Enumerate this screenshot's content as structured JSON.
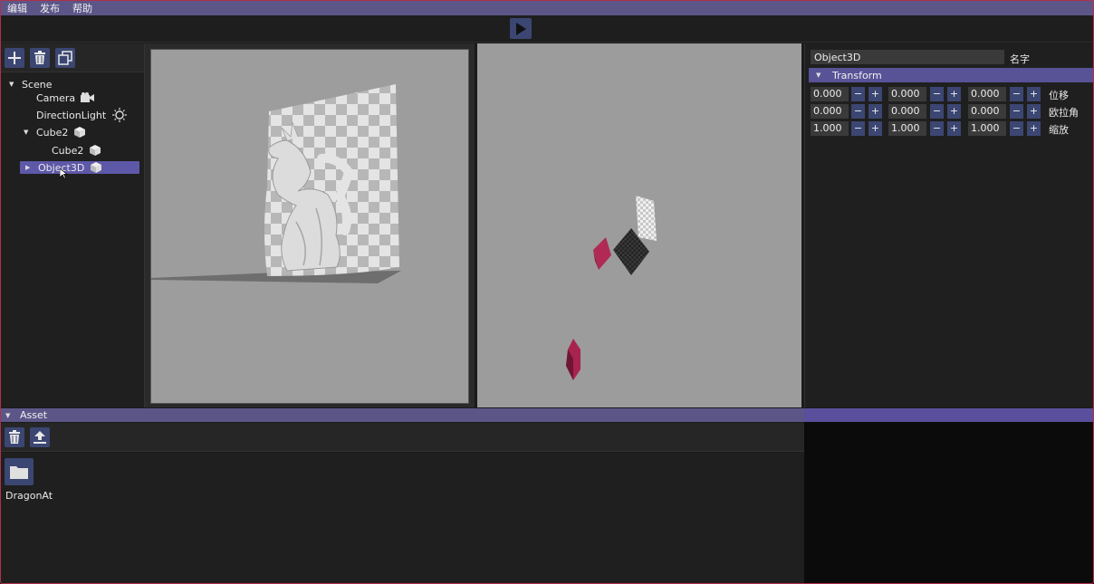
{
  "menu": {
    "items": [
      "编辑",
      "发布",
      "帮助"
    ]
  },
  "toolbar": {
    "play_icon": "play-icon"
  },
  "hierarchy": {
    "tools": [
      "add-icon",
      "trash-icon",
      "duplicate-icon"
    ],
    "items": [
      {
        "label": "Scene",
        "icon": "",
        "expanded": true
      },
      {
        "label": "Camera",
        "icon": "camera-icon"
      },
      {
        "label": "DirectionLight",
        "icon": "light-icon"
      },
      {
        "label": "Cube2",
        "icon": "cube-icon",
        "expanded": true
      },
      {
        "label": "Cube2",
        "icon": "cube-icon"
      },
      {
        "label": "Object3D",
        "icon": "cube-icon",
        "selected": true
      }
    ]
  },
  "inspector": {
    "name_value": "Object3D",
    "name_label": "名字",
    "section_title": "Transform",
    "rows": [
      {
        "label": "位移",
        "values": [
          "0.000",
          "0.000",
          "0.000"
        ]
      },
      {
        "label": "欧拉角",
        "values": [
          "0.000",
          "0.000",
          "0.000"
        ]
      },
      {
        "label": "缩放",
        "values": [
          "1.000",
          "1.000",
          "1.000"
        ]
      }
    ],
    "minus": "−",
    "plus": "+"
  },
  "asset": {
    "title": "Asset",
    "tools": [
      "trash-icon",
      "upload-icon"
    ],
    "items": [
      {
        "label": "DragonAt",
        "icon": "folder-icon"
      }
    ]
  },
  "colors": {
    "accent": "#5c5688",
    "button": "#3b4672",
    "selection": "#5e58a8",
    "viewport_bg": "#9d9d9d",
    "cube": "#a8244e"
  }
}
